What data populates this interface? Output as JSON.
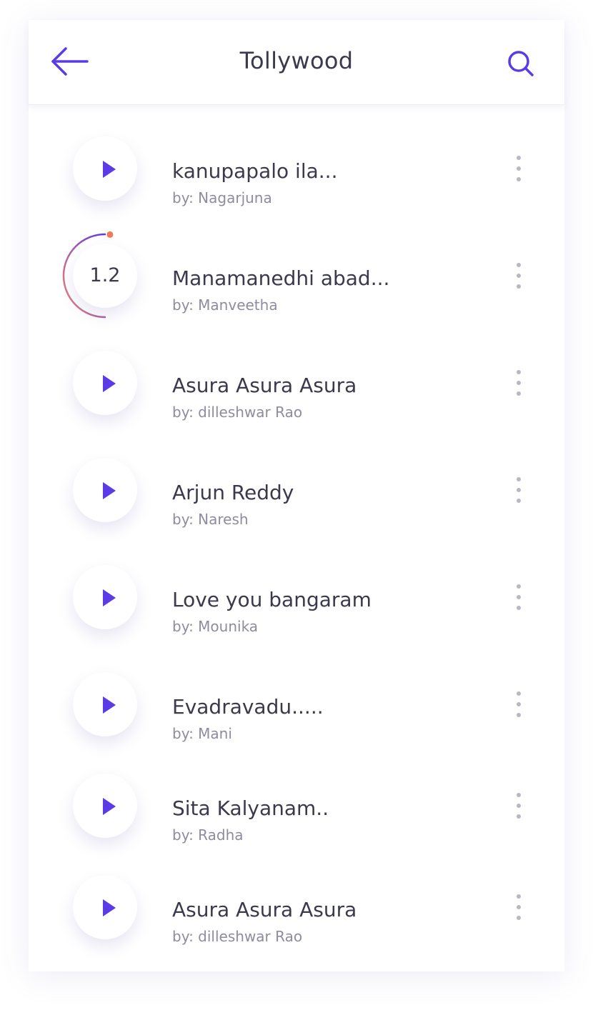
{
  "header": {
    "title": "Tollywood",
    "back_icon": "arrow-left-icon",
    "search_icon": "search-icon"
  },
  "colors": {
    "accent": "#5b3be8",
    "progress_start": "#5b3be8",
    "progress_end": "#f4856a",
    "text_primary": "#3b3a4d",
    "text_secondary": "#8e8c9e"
  },
  "songs": [
    {
      "title": "kanupapalo ila...",
      "artist": "by: Nagarjuna",
      "state": "play"
    },
    {
      "title": "Manamanedhi abad...",
      "artist": "by: Manveetha",
      "state": "playing",
      "progress_label": "1.2",
      "progress_fraction": 0.5
    },
    {
      "title": "Asura Asura Asura",
      "artist": "by: dilleshwar Rao",
      "state": "play"
    },
    {
      "title": "Arjun Reddy",
      "artist": "by: Naresh",
      "state": "play"
    },
    {
      "title": "Love you bangaram",
      "artist": "by: Mounika",
      "state": "play"
    },
    {
      "title": "Evadravadu.....",
      "artist": "by: Mani",
      "state": "play"
    },
    {
      "title": "Sita Kalyanam..",
      "artist": "by: Radha",
      "state": "play"
    },
    {
      "title": "Asura Asura Asura",
      "artist": "by: dilleshwar Rao",
      "state": "play"
    }
  ]
}
